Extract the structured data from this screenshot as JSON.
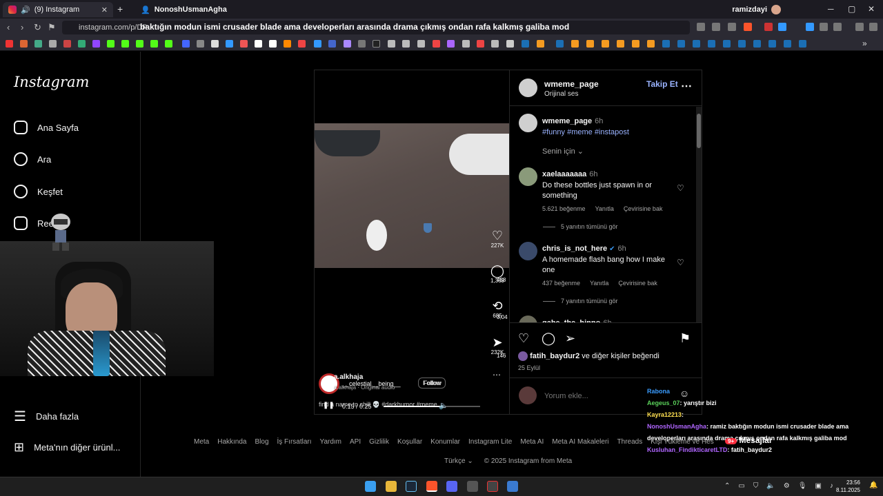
{
  "browser": {
    "tabs": [
      {
        "label": "(9) Instagram",
        "active": true
      },
      {
        "label": "NonoshUsmanAgha",
        "active": false
      }
    ],
    "profile_name": "ramizdayi",
    "url": "instagram.com/p/DP",
    "stream_title": "baktığın modun ismi crusader blade ama developerları arasında drama çıkmış ondan rafa kalkmış galiba mod"
  },
  "sidebar": {
    "logo": "Instagram",
    "items": [
      {
        "label": "Ana Sayfa",
        "icon": "home-icon"
      },
      {
        "label": "Ara",
        "icon": "search-icon"
      },
      {
        "label": "Keşfet",
        "icon": "compass-icon"
      },
      {
        "label": "Reels",
        "icon": "reels-icon"
      },
      {
        "label": "Daha fazla",
        "icon": "menu-icon"
      },
      {
        "label": "Meta'nın diğer ürünl...",
        "icon": "grid-icon"
      }
    ]
  },
  "reel": {
    "likes": "227K",
    "comments": "1,369",
    "shares": "685",
    "sends": "232K",
    "side_counts": [
      "458",
      "3,04",
      "146"
    ],
    "user": "a.alkhaja",
    "audio_user": "__celestial__being__",
    "follow": "Follow",
    "follow_overlap": "Follow",
    "audio": "a.alkhaja · Original audio",
    "caption": "find a name to chill 💀 #darkhumor #meme",
    "time": "0:15 / 0:25"
  },
  "post": {
    "author": "wmeme_page",
    "audio": "Orijinal ses",
    "follow_label": "Takip Et",
    "caption_time": "6h",
    "caption_tags": "#funny #meme #instapost",
    "sort_label": "Senin için",
    "comments": [
      {
        "user": "xaelaaaaaaa",
        "time": "6h",
        "text": "Do these bottles just spawn in or something",
        "likes": "5.621 beğenme",
        "reply": "Yanıtla",
        "translate": "Çevirisine bak",
        "replies": "5 yanıtın tümünü gör"
      },
      {
        "user": "chris_is_not_here",
        "time": "6h",
        "text": "A homemade flash bang how I make one",
        "likes": "437 beğenme",
        "reply": "Yanıtla",
        "translate": "Çevirisine bak",
        "replies": "7 yanıtın tümünü gör"
      },
      {
        "user": "gabe_the_hippo",
        "time": "6h"
      }
    ],
    "liked_by_user": "fatih_baydur2",
    "liked_by_rest": "ve diğer kişiler beğendi",
    "date": "25 Eylül",
    "comment_placeholder": "Yorum ekle..."
  },
  "chat": [
    {
      "name": "Rabona",
      "msg": "",
      "color": "n1"
    },
    {
      "name": "Aegeus_07",
      "msg": ": yarıştır bizi",
      "color": "n2"
    },
    {
      "name": "Kayra12213",
      "msg": ":",
      "color": "n3"
    },
    {
      "name": "NonoshUsmanAgha",
      "msg": ": ramiz baktığın modun ismi crusader blade ama",
      "color": "n4"
    },
    {
      "name": "",
      "msg": "developerları arasında drama çıkmış ondan rafa kalkmış galiba mod",
      "color": "n4"
    },
    {
      "name": "Kusluhan_FindikticaretLTD",
      "msg": ": fatih_baydur2",
      "color": "n4"
    }
  ],
  "footer": {
    "links": [
      "Meta",
      "Hakkında",
      "Blog",
      "İş Fırsatları",
      "Yardım",
      "API",
      "Gizlilik",
      "Koşullar",
      "Konumlar",
      "Instagram Lite",
      "Meta AI",
      "Meta AI Makaleleri",
      "Threads",
      "Kişi Yükleme ve Hes"
    ],
    "language": "Türkçe",
    "copyright": "© 2025 Instagram from Meta",
    "messages_label": "Mesajlar"
  },
  "taskbar": {
    "time": "23:56",
    "date": "8.11.2025"
  }
}
